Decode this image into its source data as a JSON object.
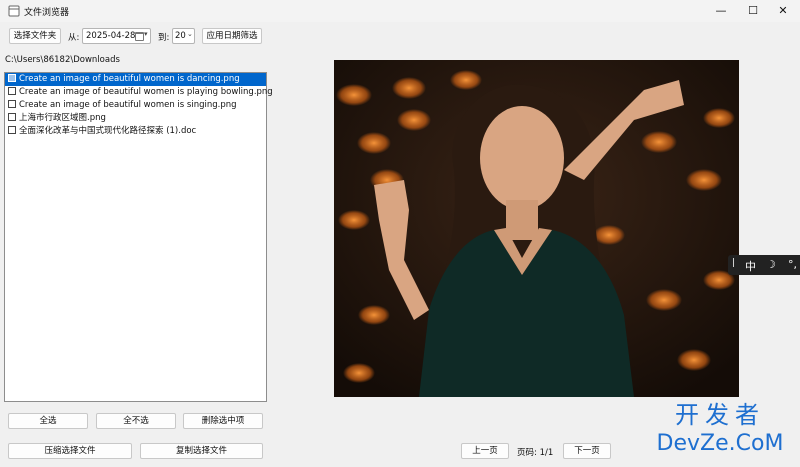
{
  "window": {
    "title": "文件浏览器",
    "minimize": "—",
    "maximize": "☐",
    "close": "✕"
  },
  "toolbar": {
    "select_folder": "选择文件夹",
    "from_label": "从:",
    "from_date": "2025-04-28",
    "to_label": "到:",
    "to_value": "20",
    "apply_filter": "应用日期筛选"
  },
  "path": "C:\\Users\\86182\\Downloads",
  "files": [
    {
      "name": "Create an image of beautiful women is dancing.png",
      "selected": true
    },
    {
      "name": "Create an image of beautiful women is playing bowling.png",
      "selected": false
    },
    {
      "name": "Create an image of beautiful women is singing.png",
      "selected": false
    },
    {
      "name": "上海市行政区域图.png",
      "selected": false
    },
    {
      "name": "全面深化改革与中国式现代化路径探索 (1).doc",
      "selected": false
    }
  ],
  "actions": {
    "select_all": "全选",
    "deselect_all": "全不选",
    "delete_selected": "删除选中项",
    "compress": "压缩选择文件",
    "copy": "复制选择文件"
  },
  "pager": {
    "prev": "上一页",
    "page_label": "页码: 1/1",
    "next": "下一页"
  },
  "ime": {
    "mode": "中",
    "moon": "☽",
    "punct": "°,"
  },
  "watermark": {
    "cn": "开发者",
    "en": "DevZe.CoM"
  },
  "colors": {
    "selection": "#0066cc",
    "watermark": "#1e6fd0"
  }
}
